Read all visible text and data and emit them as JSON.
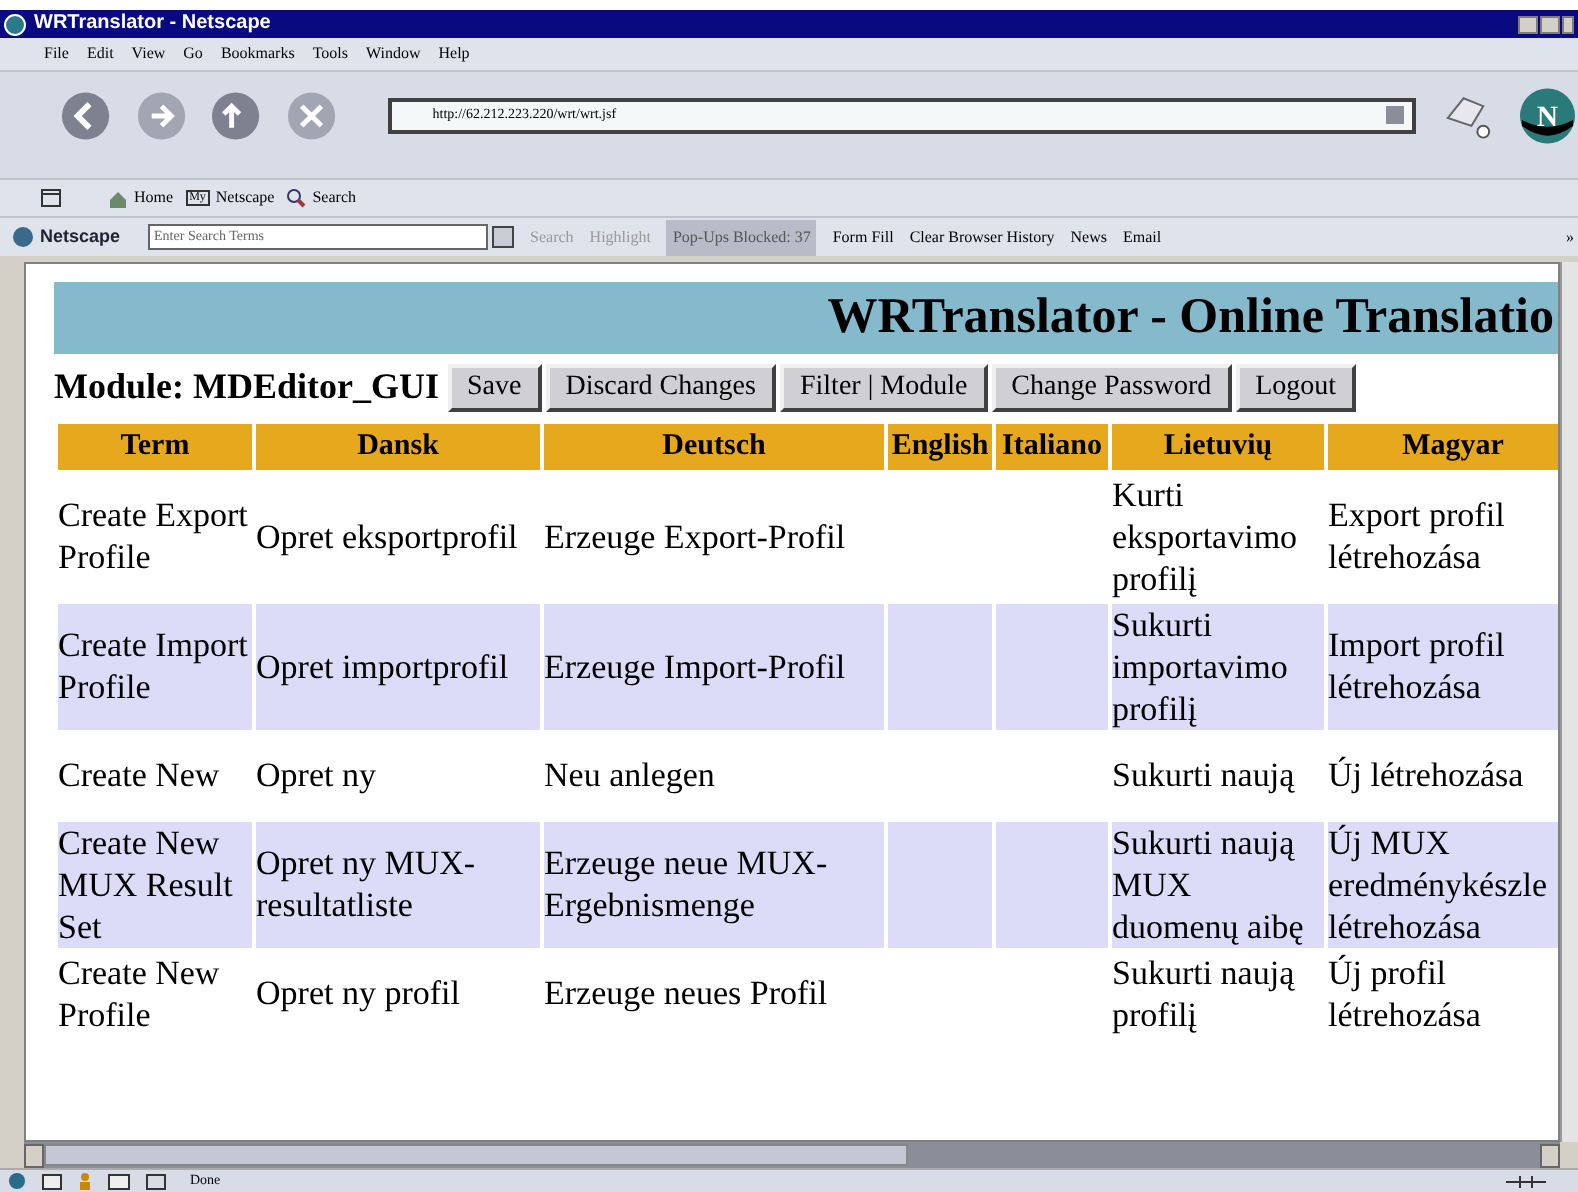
{
  "window": {
    "title": "WRTranslator - Netscape"
  },
  "menu": [
    "File",
    "Edit",
    "View",
    "Go",
    "Bookmarks",
    "Tools",
    "Window",
    "Help"
  ],
  "navigation": {
    "url": "http://62.212.223.220/wrt/wrt.jsf",
    "logo": "N"
  },
  "personal_toolbar": [
    "Home",
    "Netscape",
    "Search"
  ],
  "my_badge": "My",
  "search_toolbar": {
    "brand": "Netscape",
    "placeholder": "Enter Search Terms",
    "search": "Search",
    "highlight": "Highlight",
    "popups": "Pop-Ups Blocked: 37",
    "form_fill": "Form Fill",
    "clear_history": "Clear Browser History",
    "news": "News",
    "email": "Email",
    "more": "»"
  },
  "page": {
    "title": "WRTranslator - Online Translatio",
    "module": "Module: MDEditor_GUI",
    "buttons": [
      "Save",
      "Discard Changes",
      "Filter | Module",
      "Change Password",
      "Logout"
    ],
    "columns": [
      "Term",
      "Dansk",
      "Deutsch",
      "English",
      "Italiano",
      "Lietuvių",
      "Magyar"
    ],
    "rows": [
      {
        "cells": [
          "Create Export Profile",
          "Opret eksportprofil",
          "Erzeuge Export-Profil",
          null,
          null,
          "Kurti eksportavimo profilį",
          "Export profil létrehozása"
        ]
      },
      {
        "cells": [
          "Create Import Profile",
          "Opret importprofil",
          "Erzeuge Import-Profil",
          null,
          null,
          "Sukurti importavimo profilį",
          "Import profil létrehozása"
        ]
      },
      {
        "cells": [
          "Create New",
          "Opret ny",
          "Neu anlegen",
          null,
          null,
          "Sukurti naują",
          "Új létrehozása"
        ]
      },
      {
        "cells": [
          "Create New MUX Result Set",
          "Opret ny MUX-resultatliste",
          "Erzeuge neue MUX-Ergebnismenge",
          null,
          null,
          "Sukurti naują MUX duomenų aibę",
          "Új MUX eredménykészle létrehozása"
        ]
      },
      {
        "cells": [
          "Create New Profile",
          "Opret ny profil",
          "Erzeuge neues Profil",
          null,
          null,
          "Sukurti naują profilį",
          "Új profil létrehozása"
        ]
      }
    ]
  },
  "status_bar": {
    "text": "Done"
  }
}
